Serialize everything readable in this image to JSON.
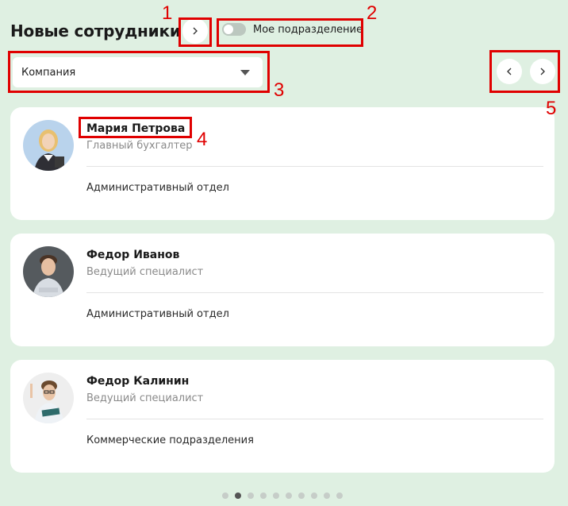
{
  "header": {
    "title": "Новые сотрудники",
    "toggle_label": "Мое подразделение"
  },
  "filter": {
    "selected": "Компания"
  },
  "employees": [
    {
      "name": "Мария Петрова",
      "role": "Главный бухгалтер",
      "department": "Административный отдел"
    },
    {
      "name": "Федор Иванов",
      "role": "Ведущий специалист",
      "department": "Административный отдел"
    },
    {
      "name": "Федор Калинин",
      "role": "Ведущий специалист",
      "department": "Коммерческие подразделения"
    }
  ],
  "pagination": {
    "dot_count": 10,
    "active_index": 1
  },
  "annotations": [
    "1",
    "2",
    "3",
    "4",
    "5"
  ],
  "colors": {
    "background": "#dff0e2",
    "card": "#ffffff",
    "annotation": "#e00000"
  }
}
